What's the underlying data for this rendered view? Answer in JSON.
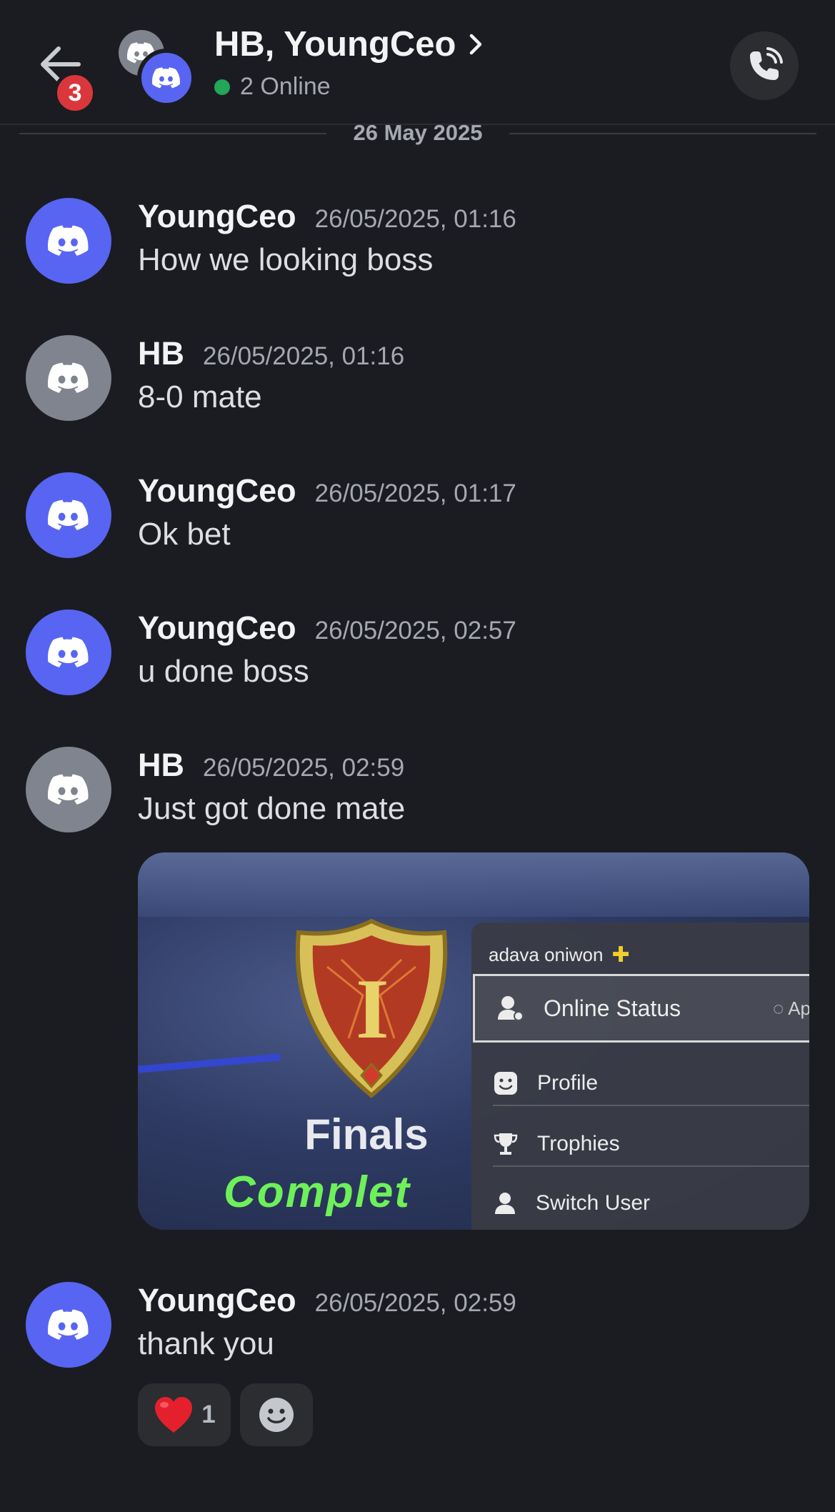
{
  "header": {
    "title": "HB, YoungCeo",
    "status": "2 Online",
    "unread_badge": "3",
    "icons": [
      "back-arrow-icon",
      "chevron-right-icon",
      "call-icon"
    ]
  },
  "date_divider": "26 May 2025",
  "messages": [
    {
      "author": "YoungCeo",
      "time": "26/05/2025, 01:16",
      "text": "How we looking boss",
      "avatar": "blurple"
    },
    {
      "author": "HB",
      "time": "26/05/2025, 01:16",
      "text": "8-0 mate",
      "avatar": "grey"
    },
    {
      "author": "YoungCeo",
      "time": "26/05/2025, 01:17",
      "text": "Ok bet",
      "avatar": "blurple"
    },
    {
      "author": "YoungCeo",
      "time": "26/05/2025, 02:57",
      "text": "u done boss",
      "avatar": "blurple"
    },
    {
      "author": "HB",
      "time": "26/05/2025, 02:59",
      "text": "Just got done mate",
      "avatar": "grey"
    },
    {
      "author": "YoungCeo",
      "time": "26/05/2025, 02:59",
      "text": "thank you",
      "avatar": "blurple"
    }
  ],
  "attachment": {
    "shield_numeral": "I",
    "finals": "Finals",
    "complete": "Complet",
    "menu": {
      "user": "adava oniwon",
      "items": [
        "Online Status",
        "Profile",
        "Trophies",
        "Switch User"
      ],
      "status_text": "Ap"
    }
  },
  "reactions": {
    "heart_emoji": "❤️",
    "heart_count": "1"
  },
  "colors": {
    "background": "#1b1c21",
    "blurple": "#5865f2",
    "grey_avatar": "#80848e",
    "badge_red": "#da373c",
    "online_green": "#23a55a"
  }
}
